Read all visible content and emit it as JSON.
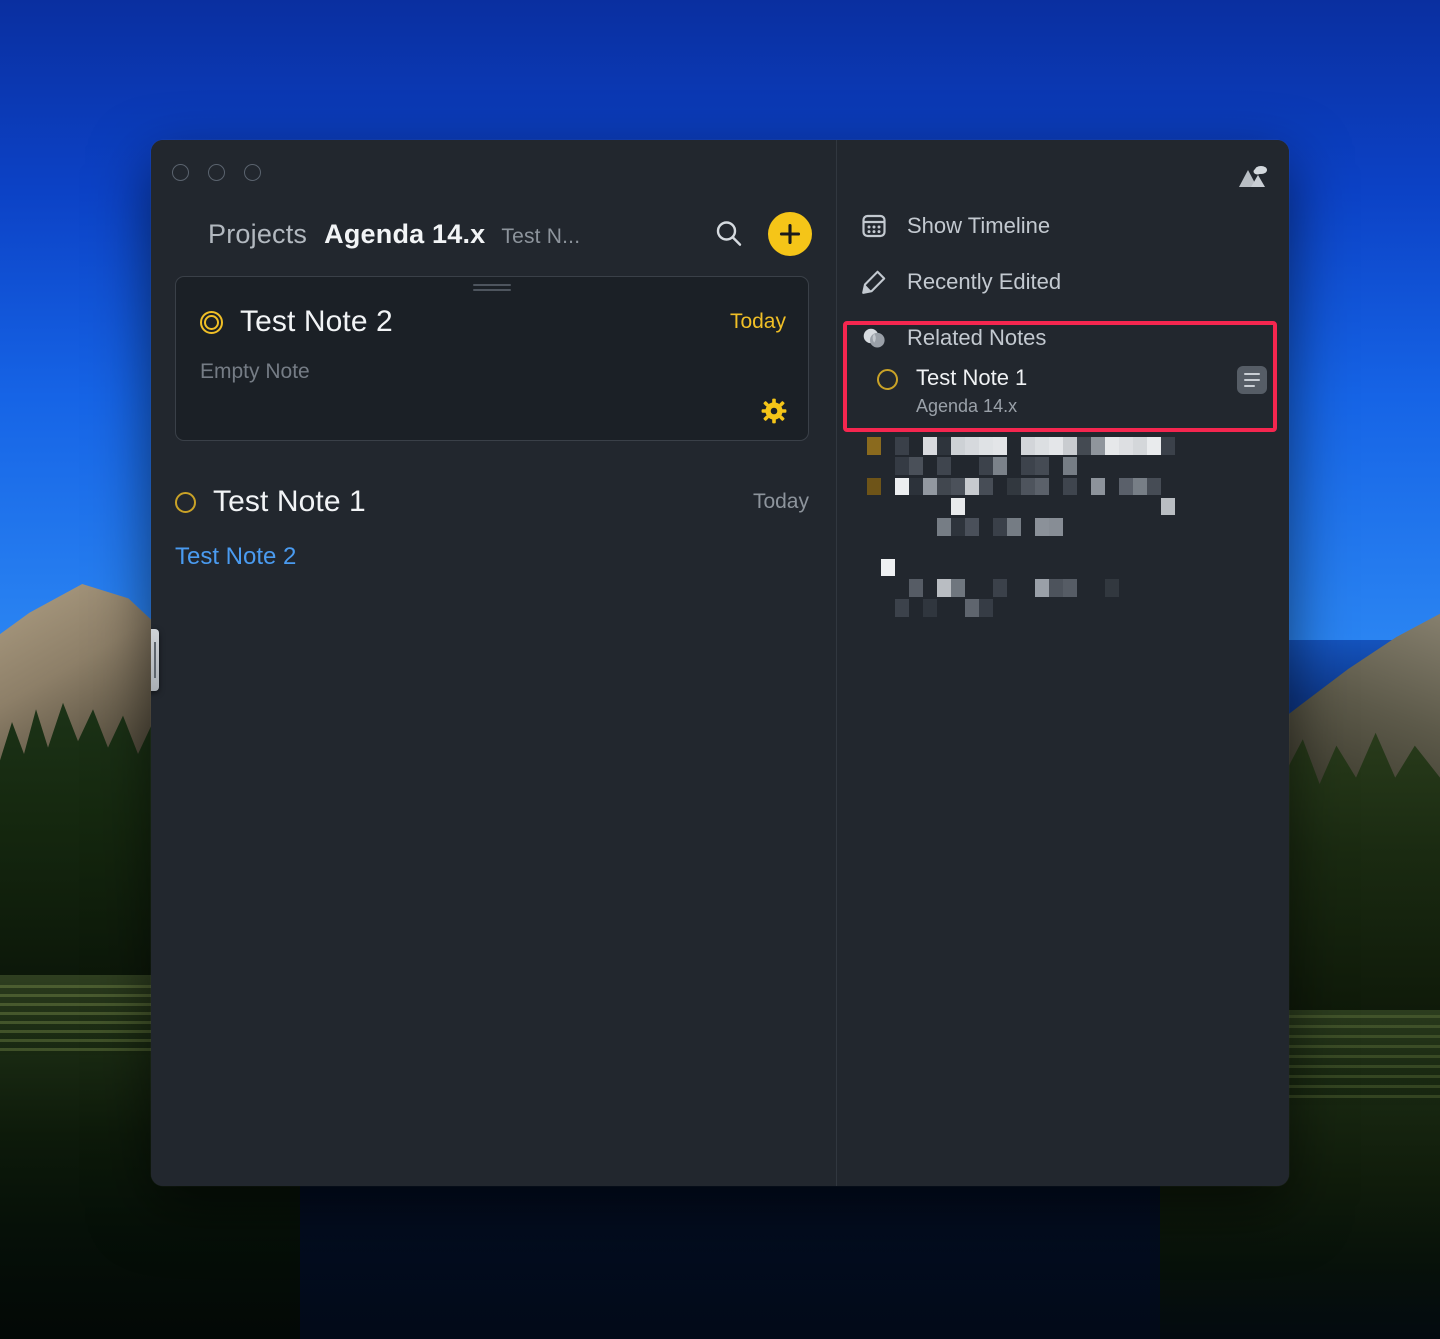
{
  "window": {
    "traffic_lights": [
      "close",
      "minimize",
      "zoom"
    ],
    "picture_icon": "mountains-picture-icon"
  },
  "breadcrumb": {
    "root": "Projects",
    "project": "Agenda 14.x",
    "note": "Test N..."
  },
  "header": {
    "search_icon": "search-icon",
    "add_icon": "plus-icon"
  },
  "notes": [
    {
      "title": "Test Note 2",
      "icon": "target-ring-icon",
      "date": "Today",
      "body": "Empty Note",
      "selected": true,
      "gear_icon": "gear-icon"
    },
    {
      "title": "Test Note 1",
      "icon": "circle-ring-icon",
      "date": "Today",
      "link": "Test Note 2",
      "selected": false
    }
  ],
  "sidebar": {
    "items": [
      {
        "label": "Show Timeline",
        "icon": "calendar-icon"
      },
      {
        "label": "Recently Edited",
        "icon": "pencil-icon"
      },
      {
        "label": "Related Notes",
        "icon": "overlapping-circles-icon"
      }
    ],
    "related": {
      "title": "Test Note 1",
      "subtitle": "Agenda 14.x",
      "status_icon": "circle-ring-icon",
      "note_icon": "note-lines-icon"
    }
  },
  "colors": {
    "accent_yellow": "#f5c518",
    "ring_yellow": "#f0bf26",
    "link_blue": "#4a9bf0",
    "highlight_red": "#f5264f",
    "window_bg": "#22272e",
    "card_bg": "#1b2026"
  },
  "pixel_block": {
    "label": "redacted-content",
    "cell": 14,
    "cells": [
      [
        0,
        0,
        "#8a6a1e"
      ],
      [
        2,
        0,
        "#3a4049"
      ],
      [
        4,
        0,
        "#d8dade"
      ],
      [
        5,
        0,
        "#2e343c"
      ],
      [
        6,
        0,
        "#cdd1d5"
      ],
      [
        7,
        0,
        "#d6d9dd"
      ],
      [
        8,
        0,
        "#dfe2e5"
      ],
      [
        9,
        0,
        "#e3e5e8"
      ],
      [
        11,
        0,
        "#d2d5d9"
      ],
      [
        12,
        0,
        "#dcdfe2"
      ],
      [
        13,
        0,
        "#e4e6e9"
      ],
      [
        14,
        0,
        "#c9ccd0"
      ],
      [
        15,
        0,
        "#444a52"
      ],
      [
        16,
        0,
        "#8f959c"
      ],
      [
        17,
        0,
        "#e6e8ea"
      ],
      [
        18,
        0,
        "#dddfe2"
      ],
      [
        19,
        0,
        "#d4d7da"
      ],
      [
        20,
        0,
        "#e9ebed"
      ],
      [
        21,
        0,
        "#3b414a"
      ],
      [
        2,
        1,
        "#353b44"
      ],
      [
        3,
        1,
        "#4a5059"
      ],
      [
        5,
        1,
        "#3f454e"
      ],
      [
        8,
        1,
        "#3c424b"
      ],
      [
        9,
        1,
        "#7b828a"
      ],
      [
        11,
        1,
        "#3d434c"
      ],
      [
        12,
        1,
        "#454b54"
      ],
      [
        14,
        1,
        "#767d85"
      ],
      [
        0,
        2,
        "#6e5418"
      ],
      [
        2,
        2,
        "#eceef0"
      ],
      [
        3,
        2,
        "#2c323a"
      ],
      [
        4,
        2,
        "#9298a0"
      ],
      [
        5,
        2,
        "#41474f"
      ],
      [
        6,
        2,
        "#4b515a"
      ],
      [
        7,
        2,
        "#c7cace"
      ],
      [
        8,
        2,
        "#474d56"
      ],
      [
        10,
        2,
        "#32383f"
      ],
      [
        11,
        2,
        "#4e545d"
      ],
      [
        12,
        2,
        "#5b616a"
      ],
      [
        14,
        2,
        "#3f454e"
      ],
      [
        16,
        2,
        "#8d939b"
      ],
      [
        18,
        2,
        "#5a606a"
      ],
      [
        19,
        2,
        "#777e86"
      ],
      [
        20,
        2,
        "#464c55"
      ],
      [
        6,
        3,
        "#e8eaec"
      ],
      [
        21,
        3,
        "#b9bdc2"
      ],
      [
        5,
        4,
        "#767d85"
      ],
      [
        6,
        4,
        "#2e343c"
      ],
      [
        7,
        4,
        "#4a505a"
      ],
      [
        9,
        4,
        "#3a4049"
      ],
      [
        10,
        4,
        "#757c84"
      ],
      [
        12,
        4,
        "#8b9199"
      ],
      [
        13,
        4,
        "#878d95"
      ],
      [
        1,
        6,
        "#eef0f2"
      ],
      [
        3,
        7,
        "#565c65"
      ],
      [
        5,
        7,
        "#b9bdc2"
      ],
      [
        6,
        7,
        "#6f767e"
      ],
      [
        9,
        7,
        "#3b414a"
      ],
      [
        12,
        7,
        "#9aa0a8"
      ],
      [
        13,
        7,
        "#4d535c"
      ],
      [
        14,
        7,
        "#565c65"
      ],
      [
        17,
        7,
        "#32383f"
      ],
      [
        2,
        8,
        "#3c424b"
      ],
      [
        4,
        8,
        "#30363e"
      ],
      [
        7,
        8,
        "#5f656e"
      ],
      [
        8,
        8,
        "#363c45"
      ]
    ]
  }
}
